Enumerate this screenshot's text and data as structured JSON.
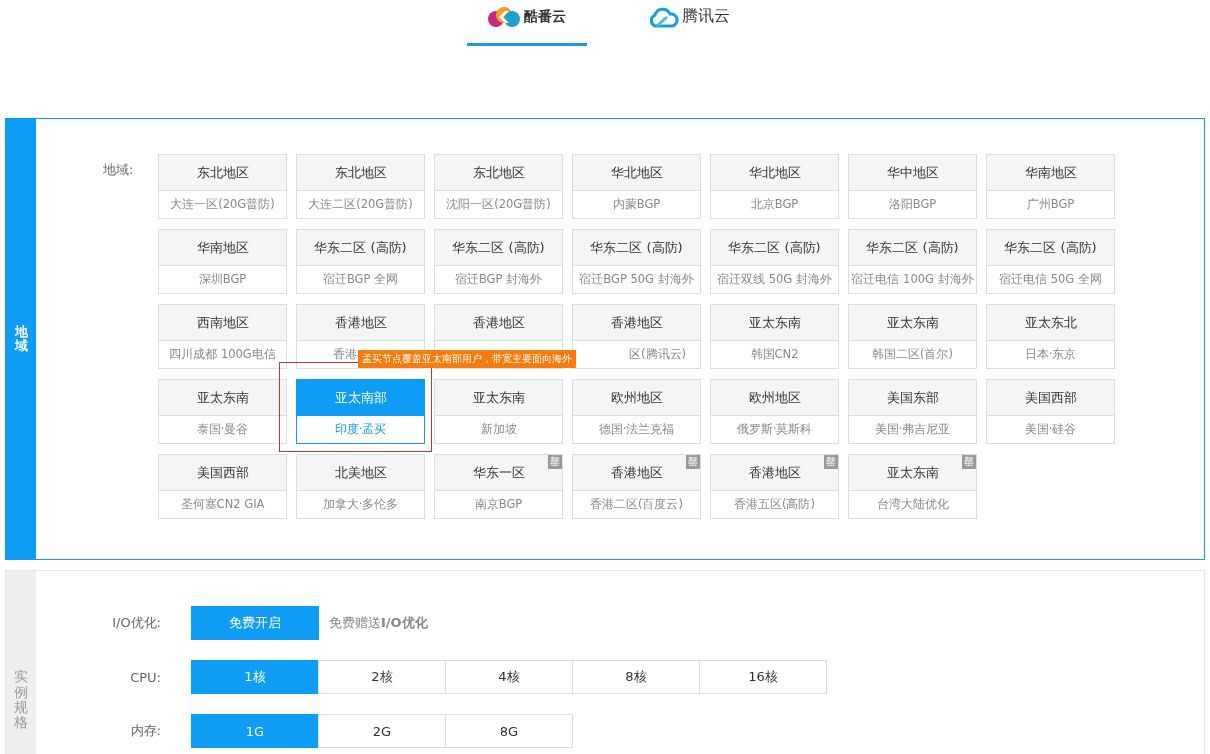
{
  "provider_tabs": [
    {
      "label": "酷番云",
      "kind": "kufan",
      "selected": true
    },
    {
      "label": "腾讯云",
      "kind": "tencent",
      "selected": false
    }
  ],
  "region_panel": {
    "side_label": "地域",
    "field_label": "地域:",
    "regions": [
      {
        "area": "东北地区",
        "zone": "大连一区(20G普防)",
        "selected": false
      },
      {
        "area": "东北地区",
        "zone": "大连二区(20G普防)",
        "selected": false
      },
      {
        "area": "东北地区",
        "zone": "沈阳一区(20G普防)",
        "selected": false
      },
      {
        "area": "华北地区",
        "zone": "内蒙BGP",
        "selected": false
      },
      {
        "area": "华北地区",
        "zone": "北京BGP",
        "selected": false
      },
      {
        "area": "华中地区",
        "zone": "洛阳BGP",
        "selected": false
      },
      {
        "area": "华南地区",
        "zone": "广州BGP",
        "selected": false
      },
      {
        "area": "华南地区",
        "zone": "深圳BGP",
        "selected": false
      },
      {
        "area": "华东二区 (高防)",
        "zone": "宿迁BGP 全网",
        "selected": false
      },
      {
        "area": "华东二区 (高防)",
        "zone": "宿迁BGP 封海外",
        "selected": false
      },
      {
        "area": "华东二区 (高防)",
        "zone": "宿迁BGP 50G 封海外",
        "selected": false
      },
      {
        "area": "华东二区 (高防)",
        "zone": "宿迁双线 50G 封海外",
        "selected": false
      },
      {
        "area": "华东二区 (高防)",
        "zone": "宿迁电信 100G 封海外",
        "selected": false
      },
      {
        "area": "华东二区 (高防)",
        "zone": "宿迁电信 50G 全网",
        "selected": false
      },
      {
        "area": "西南地区",
        "zone": "四川成都 100G电信",
        "selected": false
      },
      {
        "area": "香港地区",
        "zone": "香港",
        "kind": "cut_end",
        "selected": false
      },
      {
        "area": "香港地区",
        "selected": false
      },
      {
        "area": "香港地区",
        "zone": "区(腾讯云)",
        "kind": "cut_start",
        "selected": false
      },
      {
        "area": "亚太东南",
        "zone": "韩国CN2",
        "selected": false
      },
      {
        "area": "亚太东南",
        "zone": "韩国二区(首尔)",
        "selected": false
      },
      {
        "area": "亚太东北",
        "zone": "日本·东京",
        "selected": false
      },
      {
        "area": "亚太东南",
        "zone": "泰国·曼谷",
        "selected": false
      },
      {
        "area": "亚太南部",
        "zone": "印度·孟买",
        "selected": true,
        "tooltip": "孟买节点覆盖亚太南部用户，带宽主要面向海外"
      },
      {
        "area": "亚太东南",
        "zone": "新加坡",
        "selected": false
      },
      {
        "area": "欧州地区",
        "zone": "德国·法兰克福",
        "selected": false
      },
      {
        "area": "欧州地区",
        "zone": "俄罗斯·莫斯科",
        "selected": false
      },
      {
        "area": "美国东部",
        "zone": "美国·弗吉尼亚",
        "selected": false
      },
      {
        "area": "美国西部",
        "zone": "美国·硅谷",
        "selected": false
      },
      {
        "area": "美国西部",
        "zone": "圣何塞CN2 GIA",
        "selected": false
      },
      {
        "area": "北美地区",
        "zone": "加拿大·多伦多",
        "selected": false
      },
      {
        "area": "华东一区",
        "zone": "南京BGP",
        "badge": "罄",
        "selected": false
      },
      {
        "area": "香港地区",
        "zone": "香港二区(百度云)",
        "badge": "罄",
        "selected": false
      },
      {
        "area": "香港地区",
        "zone": "香港五区(高防)",
        "badge": "罄",
        "selected": false
      },
      {
        "area": "亚太东南",
        "zone": "台湾大陆优化",
        "badge": "罄",
        "selected": false
      }
    ]
  },
  "spec_panel": {
    "side_label": "实例规格",
    "rows": [
      {
        "label": "I/O优化:",
        "options": [
          {
            "label": "免费开启",
            "selected": true
          }
        ],
        "note": "免费赠送**I/O优化**"
      },
      {
        "label": "CPU:",
        "options": [
          {
            "label": "1核",
            "selected": true
          },
          {
            "label": "2核",
            "selected": false
          },
          {
            "label": "4核",
            "selected": false
          },
          {
            "label": "8核",
            "selected": false
          },
          {
            "label": "16核",
            "selected": false
          }
        ]
      },
      {
        "label": "内存:",
        "options": [
          {
            "label": "1G",
            "selected": true
          },
          {
            "label": "2G",
            "selected": false
          },
          {
            "label": "8G",
            "selected": false
          }
        ]
      }
    ]
  }
}
